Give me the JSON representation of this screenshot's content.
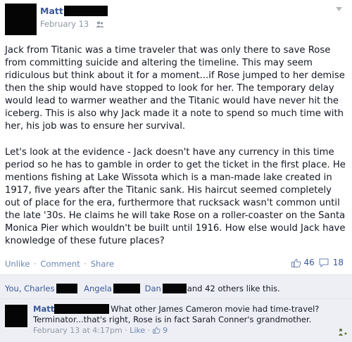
{
  "author": {
    "name": "Matt"
  },
  "meta": {
    "date": "February 13"
  },
  "post": {
    "paragraphs": [
      "Jack from Titanic was a time traveler that was only there to save Rose from committing suicide and altering the timeline. This may seem ridiculous but think about it for a moment...if Rose jumped to her demise then the ship would have stopped to look for her. The temporary delay would lead to warmer weather and the Titanic would have never hit the iceberg. This is also why Jack made it a note to spend so much time with her, his job was to ensure her survival.",
      "Let's look at the evidence - Jack doesn't have any currency in this time period so he has to gamble in order to get the ticket in the first place. He mentions fishing at Lake Wissota which is a man-made lake created in 1917, five years after the Titanic sank. His haircut seemed completely out of place for the era, furthermore that rucksack wasn't common until the late '30s. He claims he will take Rose on a roller-coaster on the Santa Monica Pier which wouldn't be built until 1916. How else would Jack have knowledge of these future places?"
    ]
  },
  "actions": {
    "unlike": "Unlike",
    "comment": "Comment",
    "share": "Share",
    "sep": "·"
  },
  "counts": {
    "likes": "46",
    "comments": "18"
  },
  "likes_line": {
    "prefix": "You, Charles",
    "name2": "Angela",
    "name3": "Dan",
    "suffix": "and 42 others like this."
  },
  "comment": {
    "name": "Matt",
    "text": "What other James Cameron movie had time-travel? Terminator...that's right, Rose is in fact Sarah Conner's grandmother.",
    "time": "February 13 at 4:17pm",
    "like": "Like",
    "sep": "·",
    "like_count": "9"
  },
  "colors": {
    "link": "#3b5998",
    "ufi_bg": "#edeff4",
    "text": "#141823",
    "muted": "#9197a3"
  },
  "icons": [
    "audience-friends-icon",
    "chevron-down-icon",
    "thumbs-up-icon",
    "comment-bubble-icon",
    "corner-icon"
  ]
}
